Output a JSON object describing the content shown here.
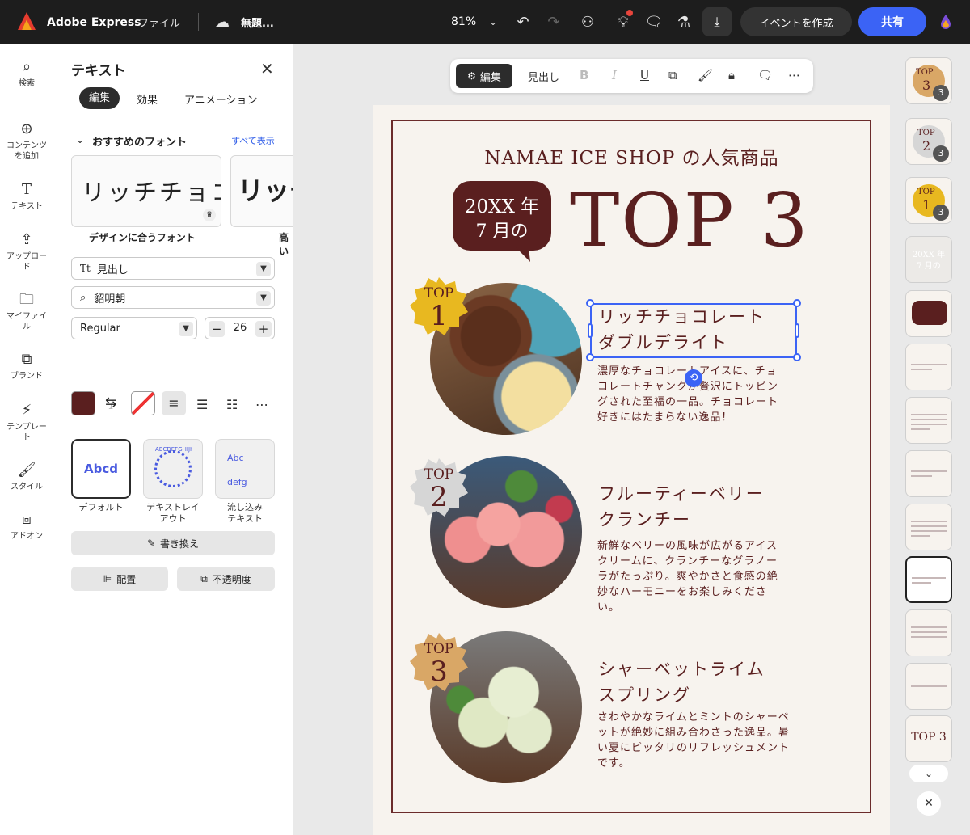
{
  "topbar": {
    "app_name": "Adobe Express",
    "file_menu": "ファイル",
    "doc_title": "無題...",
    "zoom": "81%",
    "create_event": "イベントを作成",
    "share": "共有"
  },
  "rail": {
    "items": [
      "検索",
      "コンテンツ\nを追加",
      "テキスト",
      "アップロー\nド",
      "マイファイ\nル",
      "ブランド",
      "テンプレー\nト",
      "スタイル",
      "アドオン"
    ]
  },
  "panel": {
    "title": "テキスト",
    "tabs": [
      "編集",
      "効果",
      "アニメーション"
    ],
    "section": "おすすめのフォント",
    "show_all": "すべて表示",
    "font_card_1": "リッチチョコ",
    "font_card_2": "リッチ",
    "font_card_label_1": "デザインに合うフォント",
    "font_card_label_2": "高い",
    "style_select": "見出し",
    "font_select": "貂明朝",
    "weight_select": "Regular",
    "size": "26",
    "layouts": [
      {
        "label": "デフォルト",
        "sample": "Abcd"
      },
      {
        "label": "テキストレイ\nアウト",
        "sample": "ABCDEFGHIJKL"
      },
      {
        "label": "流し込み\nテキスト",
        "sample": "Abc\ndefg"
      }
    ],
    "rewrite": "書き換え",
    "arrange": "配置",
    "opacity": "不透明度"
  },
  "floating_toolbar": {
    "edit": "編集",
    "heading": "見出し"
  },
  "poster": {
    "subtitle": "NAMAE ICE SHOP の人気商品",
    "bubble_line1": "20XX 年",
    "bubble_line2": "7 月の",
    "headline": "TOP 3",
    "items": [
      {
        "badge_top": "TOP",
        "badge_num": "1",
        "title": "リッチチョコレート\nダブルデライト",
        "desc": "濃厚なチョコレートアイスに、チョ\nコレートチャンクが贅沢にトッピン\nグされた至福の一品。チョコレート\n好きにはたまらない逸品！"
      },
      {
        "badge_top": "TOP",
        "badge_num": "2",
        "title": "フルーティーベリー\nクランチー",
        "desc": "新鮮なベリーの風味が広がるアイス\nクリームに、クランチーなグラノー\nラがたっぷり。爽やかさと食感の絶\n妙なハーモニーをお楽しみくださ\nい。"
      },
      {
        "badge_top": "TOP",
        "badge_num": "3",
        "title": "シャーベットライム\nスプリング",
        "desc": "さわやかなライムとミントのシャーベ\nットが絶妙に組み合わさった逸品。暑\nい夏にピッタリのリフレッシュメント\nです。"
      }
    ]
  },
  "thumbs": {
    "count_badge": "3",
    "t1_top": "TOP",
    "t1_num": "3",
    "t2_top": "TOP",
    "t2_num": "2",
    "t3_top": "TOP",
    "t3_num": "1",
    "t4_a": "20XX 年",
    "t4_b": "7 月の",
    "t14": "TOP 3"
  },
  "colors": {
    "maroon": "#5a1f1f",
    "accent_blue": "#3b63f5",
    "gold": "#e8b820",
    "silver": "#d6d6d6",
    "bronze": "#d9a766"
  }
}
